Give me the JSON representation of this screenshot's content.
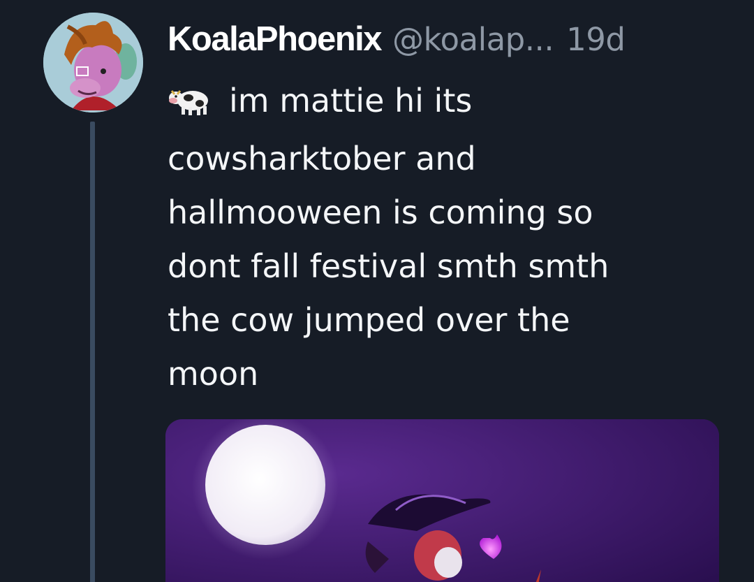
{
  "post": {
    "display_name": "KoalaPhoenix",
    "handle": "@koalap...",
    "timestamp": "19d",
    "emoji": "cow-emoji",
    "text_lines": [
      "im mattie hi its",
      "cowsharktober and",
      "hallmooween is coming  so",
      "dont fall festival smth smth",
      "the cow jumped over the",
      "moon"
    ]
  },
  "colors": {
    "background": "#161c26",
    "thread_line": "#3a4b60",
    "text_primary": "#f4f6f8",
    "text_secondary": "#8e98a5",
    "media_purple": "#3a1666"
  }
}
